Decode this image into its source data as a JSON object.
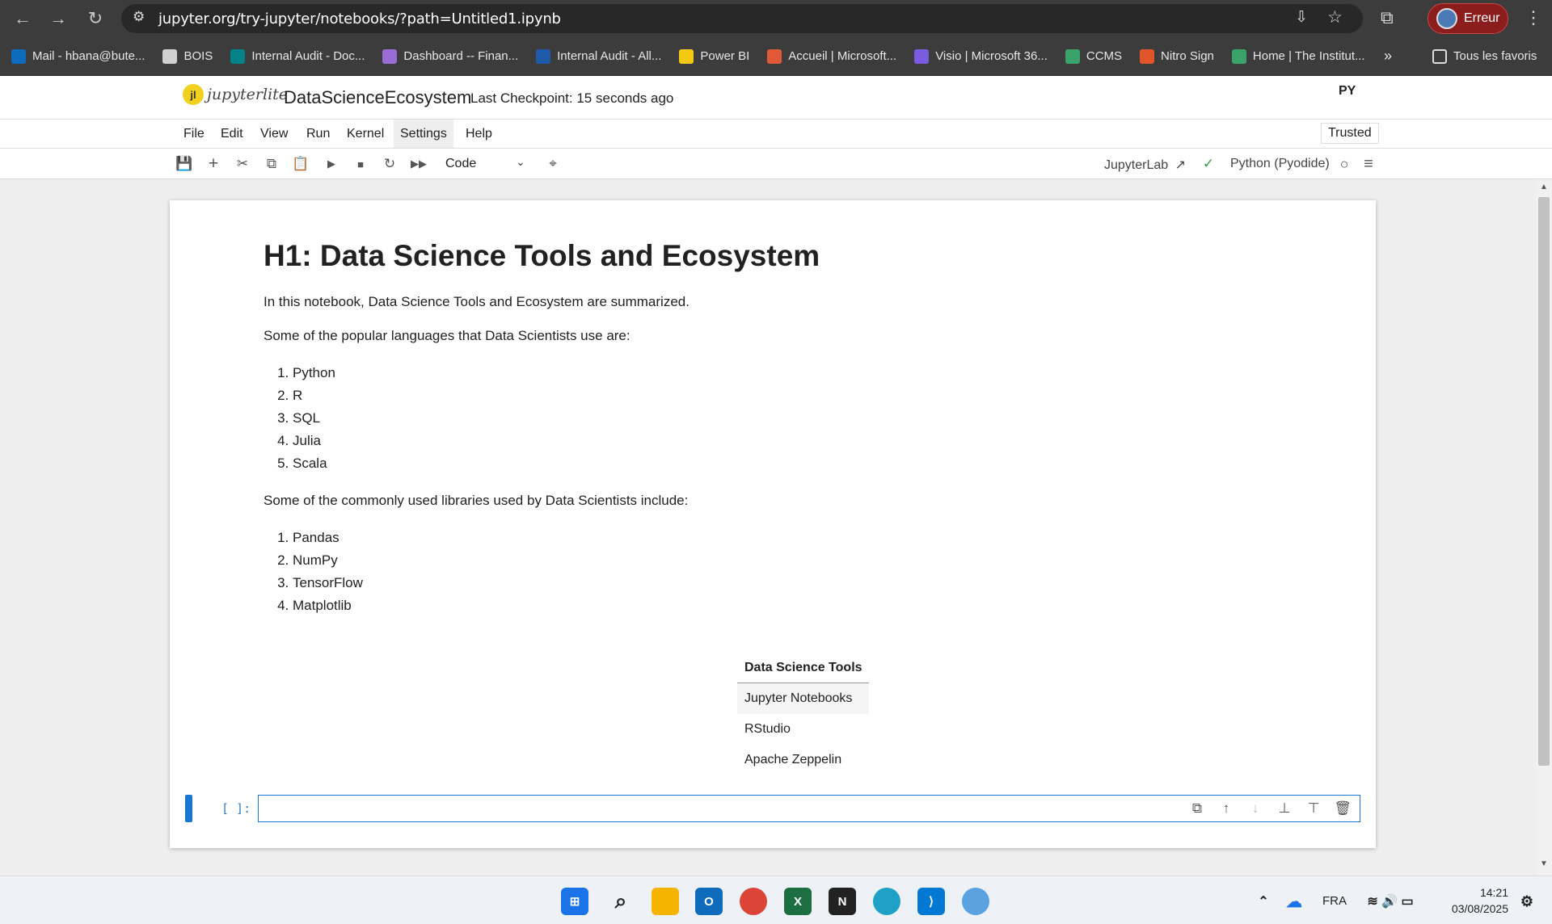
{
  "browser": {
    "url": "jupyter.org/try-jupyter/notebooks/?path=Untitled1.ipynb",
    "profile_label": "Erreur",
    "bookmarks": [
      {
        "label": "Mail - hbana@bute...",
        "color": "#0f6cbd"
      },
      {
        "label": "BOIS",
        "color": "#d0d0d0"
      },
      {
        "label": "Internal Audit - Doc...",
        "color": "#038387"
      },
      {
        "label": "Dashboard -- Finan...",
        "color": "#9b6cd6"
      },
      {
        "label": "Internal Audit - All...",
        "color": "#1f5aa8"
      },
      {
        "label": "Power BI",
        "color": "#f2c811"
      },
      {
        "label": "Accueil | Microsoft...",
        "color": "#e05a3a"
      },
      {
        "label": "Visio | Microsoft 36...",
        "color": "#7b5be0"
      },
      {
        "label": "CCMS",
        "color": "#3aa36b"
      },
      {
        "label": "Nitro Sign",
        "color": "#e0552a"
      },
      {
        "label": "Home | The Institut...",
        "color": "#3aa36b"
      }
    ],
    "more_bookmarks": "»",
    "all_bookmarks_label": "Tous les favoris"
  },
  "jupyter": {
    "logo_text": "jupyterlite",
    "notebook_name": "DataScienceEcosystem",
    "checkpoint": "Last Checkpoint: 15 seconds ago",
    "py_logo": "PY",
    "menus": [
      "File",
      "Edit",
      "View",
      "Run",
      "Kernel",
      "Settings",
      "Help"
    ],
    "trusted": "Trusted",
    "cell_type": "Code",
    "jupyterlab_link": "JupyterLab",
    "kernel": "Python (Pyodide)"
  },
  "notebook": {
    "heading": "H1: Data Science Tools and Ecosystem",
    "intro": "In this notebook, Data Science Tools and Ecosystem are summarized.",
    "languages_intro": "Some of the popular languages that Data Scientists use are:",
    "languages": [
      "Python",
      "R",
      "SQL",
      "Julia",
      "Scala"
    ],
    "libraries_intro": "Some of the commonly used libraries used by Data Scientists include:",
    "libraries": [
      "Pandas",
      "NumPy",
      "TensorFlow",
      "Matplotlib"
    ],
    "table": {
      "header": "Data Science Tools",
      "rows": [
        "Jupyter Notebooks",
        "RStudio",
        "Apache Zeppelin"
      ]
    },
    "code_prompt": "[ ]:",
    "code_value": ""
  },
  "taskbar": {
    "language": "FRA",
    "time": "14:21",
    "date": "03/08/2025"
  }
}
